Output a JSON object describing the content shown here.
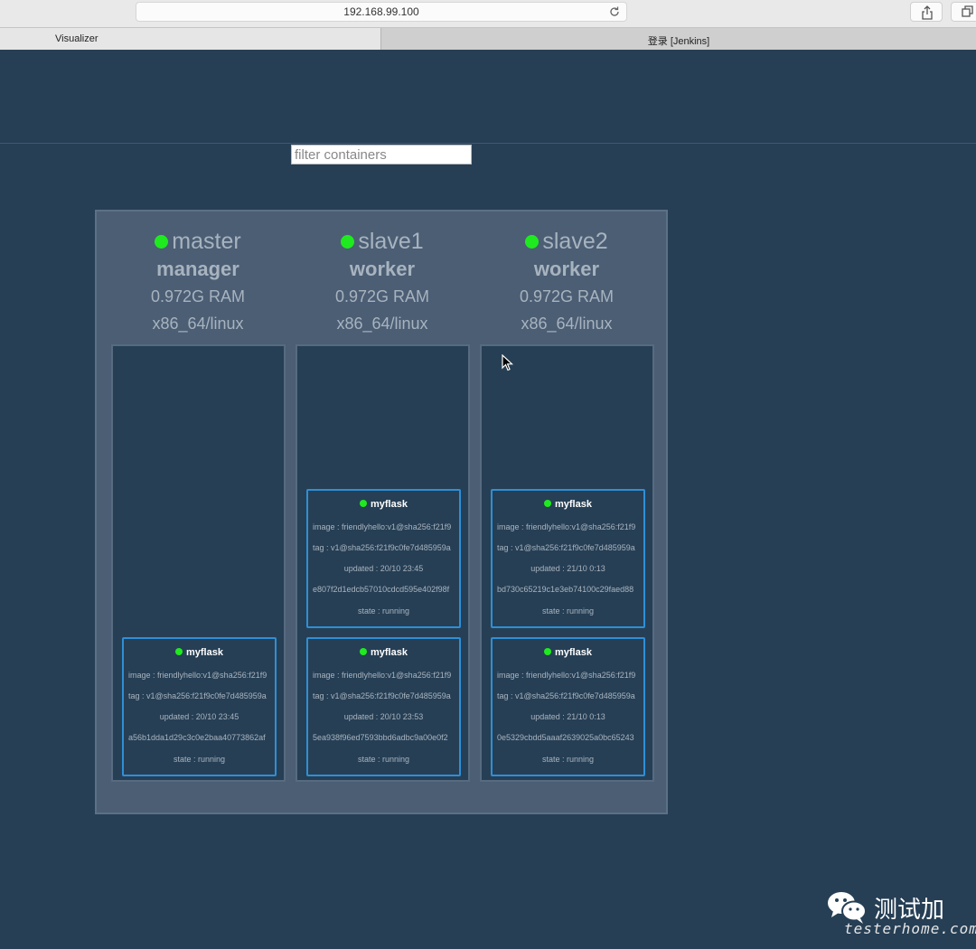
{
  "browser": {
    "url": "192.168.99.100",
    "tabs": [
      {
        "label": "Visualizer",
        "active": true
      },
      {
        "label": "登录 [Jenkins]",
        "active": false
      }
    ]
  },
  "filter": {
    "placeholder": "filter containers",
    "value": ""
  },
  "nodes": [
    {
      "name": "master",
      "role": "manager",
      "ram": "0.972G RAM",
      "arch": "x86_64/linux",
      "status": "up",
      "containers": [
        {
          "name": "myflask",
          "image": "image : friendlyhello:v1@sha256:f21f9",
          "tag": "tag : v1@sha256:f21f9c0fe7d485959a",
          "updated": "updated : 20/10 23:45",
          "id": "a56b1dda1d29c3c0e2baa40773862af",
          "state": "state : running"
        }
      ]
    },
    {
      "name": "slave1",
      "role": "worker",
      "ram": "0.972G RAM",
      "arch": "x86_64/linux",
      "status": "up",
      "containers": [
        {
          "name": "myflask",
          "image": "image : friendlyhello:v1@sha256:f21f9",
          "tag": "tag : v1@sha256:f21f9c0fe7d485959a",
          "updated": "updated : 20/10 23:45",
          "id": "e807f2d1edcb57010cdcd595e402f98f",
          "state": "state : running"
        },
        {
          "name": "myflask",
          "image": "image : friendlyhello:v1@sha256:f21f9",
          "tag": "tag : v1@sha256:f21f9c0fe7d485959a",
          "updated": "updated : 20/10 23:53",
          "id": "5ea938f96ed7593bbd6adbc9a00e0f2",
          "state": "state : running"
        }
      ]
    },
    {
      "name": "slave2",
      "role": "worker",
      "ram": "0.972G RAM",
      "arch": "x86_64/linux",
      "status": "up",
      "containers": [
        {
          "name": "myflask",
          "image": "image : friendlyhello:v1@sha256:f21f9",
          "tag": "tag : v1@sha256:f21f9c0fe7d485959a",
          "updated": "updated : 21/10 0:13",
          "id": "bd730c65219c1e3eb74100c29faed88",
          "state": "state : running"
        },
        {
          "name": "myflask",
          "image": "image : friendlyhello:v1@sha256:f21f9",
          "tag": "tag : v1@sha256:f21f9c0fe7d485959a",
          "updated": "updated : 21/10 0:13",
          "id": "0e5329cbdd5aaaf2639025a0bc65243",
          "state": "state : running"
        }
      ]
    }
  ],
  "watermark": {
    "title": "测试加",
    "subtitle": "testerhome.com"
  },
  "colors": {
    "background": "#263f55",
    "cluster": "#4b5e74",
    "status_up": "#1fea1f",
    "card_border": "#2f8fd6"
  }
}
